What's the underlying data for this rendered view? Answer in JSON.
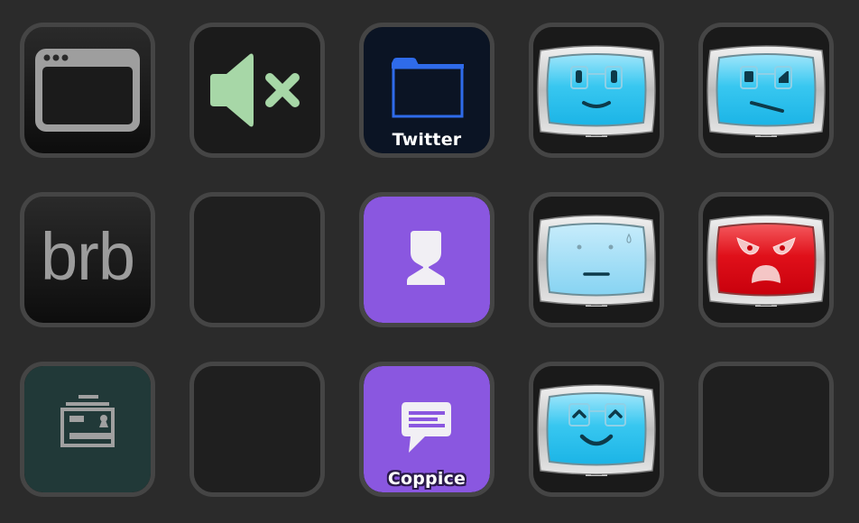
{
  "app": "stream-deck-button-grid",
  "colors": {
    "background": "#2b2b2b",
    "key_border": "#454545",
    "purple": "#8a57e0",
    "folder_blue": "#2f6bea",
    "mute_green": "#a7d7a7",
    "tv_blue": "#2fc6f0",
    "tv_red": "#e0101a",
    "teal": "#213938"
  },
  "keys": [
    {
      "row": 1,
      "col": 1,
      "type": "app-window",
      "icon": "browser-window-icon",
      "label": ""
    },
    {
      "row": 1,
      "col": 2,
      "type": "mute",
      "icon": "speaker-mute-icon",
      "label": ""
    },
    {
      "row": 1,
      "col": 3,
      "type": "folder",
      "icon": "folder-icon",
      "label": "Twitter"
    },
    {
      "row": 1,
      "col": 4,
      "type": "avatar-expression",
      "icon": "tv-face-smile-icon",
      "label": ""
    },
    {
      "row": 1,
      "col": 5,
      "type": "avatar-expression",
      "icon": "tv-face-skeptical-icon",
      "label": ""
    },
    {
      "row": 2,
      "col": 1,
      "type": "text",
      "icon": "",
      "label": "brb"
    },
    {
      "row": 2,
      "col": 2,
      "type": "empty",
      "icon": "",
      "label": ""
    },
    {
      "row": 2,
      "col": 3,
      "type": "action",
      "icon": "user-silhouette-icon",
      "label": ""
    },
    {
      "row": 2,
      "col": 4,
      "type": "avatar-expression",
      "icon": "tv-face-neutral-icon",
      "label": ""
    },
    {
      "row": 2,
      "col": 5,
      "type": "avatar-expression",
      "icon": "tv-face-angry-icon",
      "label": ""
    },
    {
      "row": 3,
      "col": 1,
      "type": "action",
      "icon": "id-badge-icon",
      "label": ""
    },
    {
      "row": 3,
      "col": 2,
      "type": "empty",
      "icon": "",
      "label": ""
    },
    {
      "row": 3,
      "col": 3,
      "type": "chat",
      "icon": "chat-bubble-icon",
      "label": "Coppice"
    },
    {
      "row": 3,
      "col": 4,
      "type": "avatar-expression",
      "icon": "tv-face-happy-icon",
      "label": ""
    },
    {
      "row": 3,
      "col": 5,
      "type": "empty",
      "icon": "",
      "label": ""
    }
  ]
}
